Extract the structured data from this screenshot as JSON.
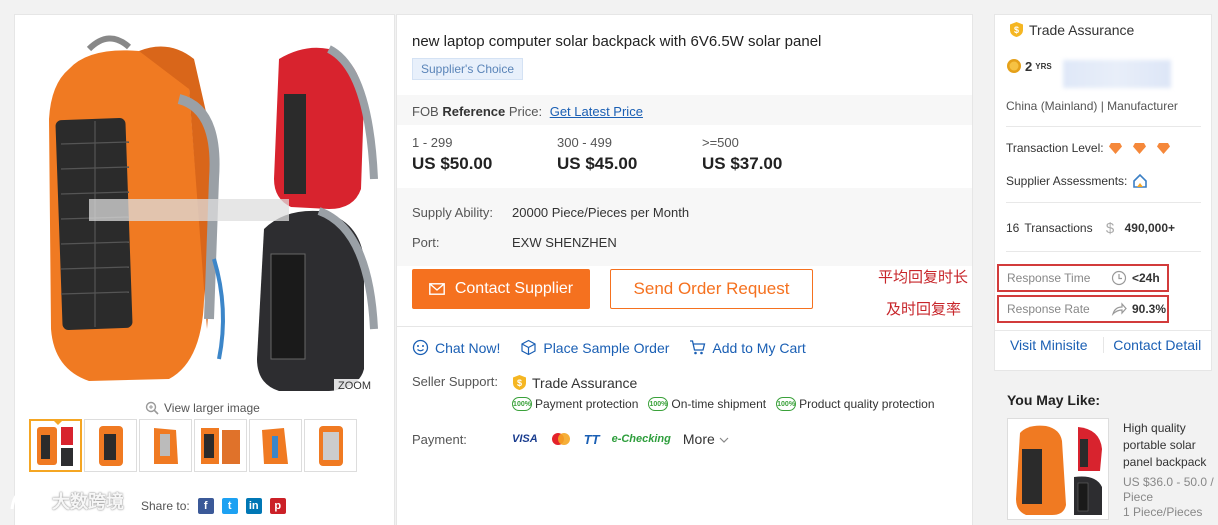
{
  "gallery": {
    "zoom_label": "ZOOM",
    "view_larger": "View larger image",
    "share_label": "Share to:",
    "share_networks": [
      "facebook-icon",
      "twitter-icon",
      "linkedin-icon",
      "pinterest-icon"
    ],
    "thumb_count": 6
  },
  "watermark": {
    "text": "大数跨境"
  },
  "product": {
    "title": "new laptop computer solar backpack with 6V6.5W solar panel",
    "badge": "Supplier's Choice",
    "fob_prefix": "FOB",
    "fob_ref": "Reference",
    "fob_price_label": "Price:",
    "fob_link": "Get Latest Price",
    "tiers": [
      {
        "qty": "1 - 299",
        "price": "US $50.00"
      },
      {
        "qty": "300 - 499",
        "price": "US $45.00"
      },
      {
        "qty": ">=500",
        "price": "US $37.00"
      }
    ],
    "supply_label": "Supply Ability:",
    "supply_value": "20000 Piece/Pieces per Month",
    "port_label": "Port:",
    "port_value": "EXW SHENZHEN",
    "contact_button": "Contact Supplier",
    "order_button": "Send Order Request",
    "actions": {
      "chat": "Chat Now!",
      "sample": "Place Sample Order",
      "cart": "Add to My Cart"
    },
    "seller_support_label": "Seller Support:",
    "trade_assurance": "Trade Assurance",
    "support_items": [
      "Payment protection",
      "On-time shipment",
      "Product quality protection"
    ],
    "support_badge": "100%",
    "payment_label": "Payment:",
    "payment_methods": [
      "VISA",
      "TT",
      "e-Checking"
    ],
    "payment_more": "More"
  },
  "annotations": {
    "response_time_cn": "平均回复时长",
    "response_rate_cn": "及时回复率"
  },
  "supplier": {
    "header": "Trade Assurance",
    "years": "2",
    "years_unit": "YRS",
    "origin": "China (Mainland) | Manufacturer",
    "transaction_level_label": "Transaction Level:",
    "assessments_label": "Supplier Assessments:",
    "transactions_count": "16",
    "transactions_label": "Transactions",
    "transactions_amount": "490,000+",
    "response_time_label": "Response Time",
    "response_time_value": "<24h",
    "response_rate_label": "Response Rate",
    "response_rate_value": "90.3%",
    "visit_minisite": "Visit Minisite",
    "contact_detail": "Contact Detail"
  },
  "may_like": {
    "title": "You May Like:",
    "name": "High quality portable solar panel backpack",
    "price": "US $36.0 - 50.0 / Piece",
    "moq": "1 Piece/Pieces"
  },
  "colors": {
    "accent_orange": "#f5711f",
    "link_blue": "#1a5fb4",
    "annotation_red": "#c7252a"
  }
}
